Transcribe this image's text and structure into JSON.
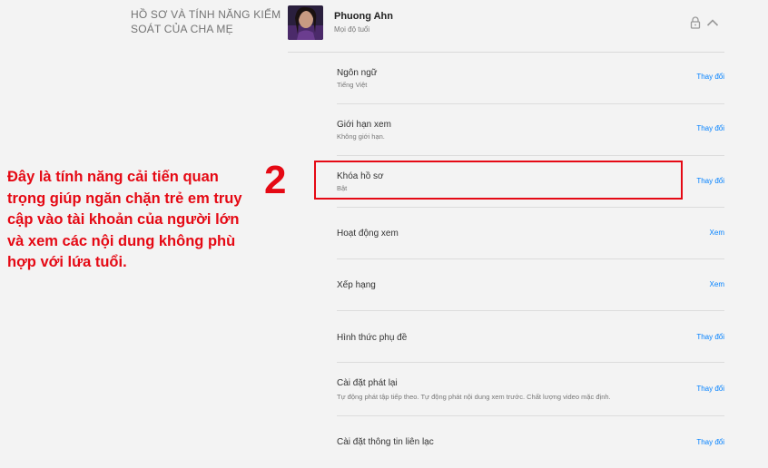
{
  "section": {
    "title": "HỒ SƠ VÀ TÍNH NĂNG KIỂM SOÁT CỦA CHA MẸ"
  },
  "profile": {
    "name": "Phuong Ahn",
    "rating": "Mọi độ tuổi"
  },
  "icons": {
    "lock": "lock-icon",
    "collapse": "chevron-up-icon"
  },
  "settings": [
    {
      "label": "Ngôn ngữ",
      "value": "Tiếng Việt",
      "action": "Thay đổi"
    },
    {
      "label": "Giới hạn xem",
      "value": "Không giới hạn.",
      "action": "Thay đổi"
    },
    {
      "label": "Khóa hồ sơ",
      "value": "Bật",
      "action": "Thay đổi"
    },
    {
      "label": "Hoạt động xem",
      "value": "",
      "action": "Xem"
    },
    {
      "label": "Xếp hạng",
      "value": "",
      "action": "Xem"
    },
    {
      "label": "Hình thức phụ đề",
      "value": "",
      "action": "Thay đổi"
    },
    {
      "label": "Cài đặt phát lại",
      "value": "Tự động phát tập tiếp theo. Tự động phát nội dung xem trước. Chất lượng video mặc định.",
      "action": "Thay đổi"
    },
    {
      "label": "Cài đặt thông tin liên lạc",
      "value": "",
      "action": "Thay đổi"
    }
  ],
  "annotation": {
    "number": "2",
    "text": "Đây là tính năng cải tiến quan trọng giúp ngăn chặn trẻ em truy cập vào tài khoản của người lớn và xem các nội dung không phù hợp với lứa tuổi."
  },
  "colors": {
    "accent_red": "#e50914",
    "link_blue": "#0080ff"
  }
}
